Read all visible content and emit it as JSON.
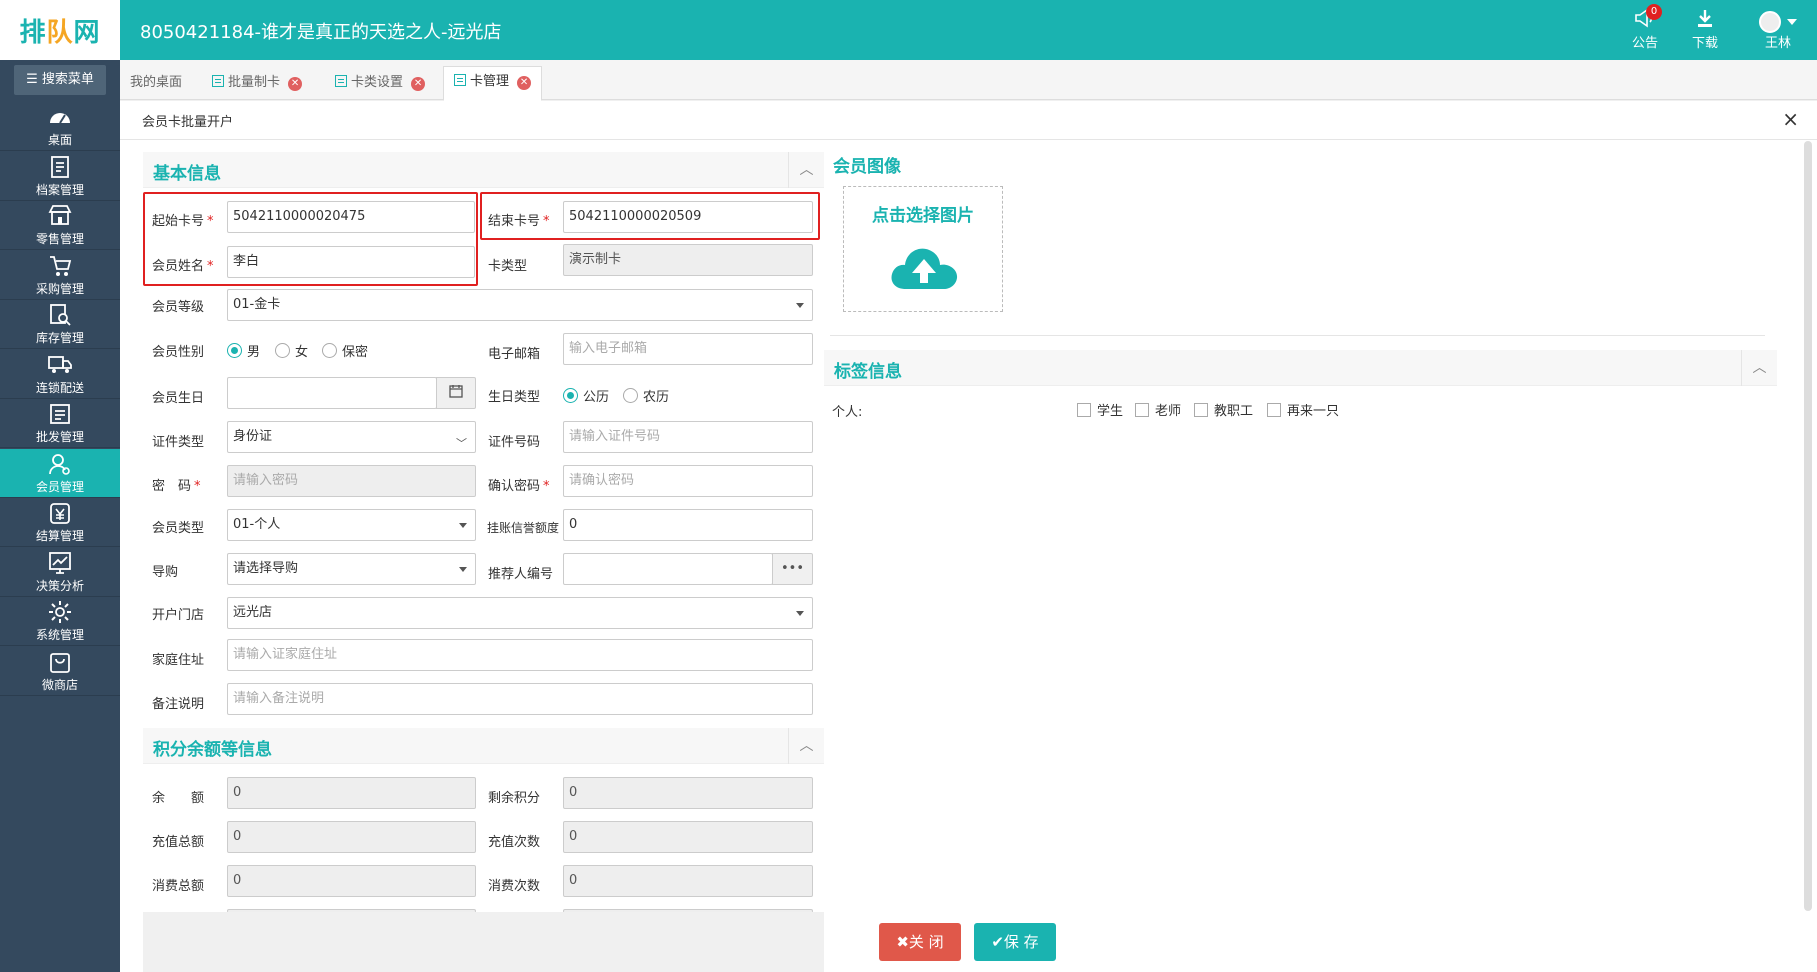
{
  "header": {
    "logo_main": "排",
    "logo_mid": "队",
    "logo_end": "网",
    "store_title": "8050421184-谁才是真正的天选之人-远光店",
    "announce_label": "公告",
    "announce_count": "0",
    "download_label": "下载",
    "user_name": "王林"
  },
  "sidebar": {
    "search_label": "搜索菜单",
    "items": [
      {
        "label": "桌面",
        "icon": "dashboard-icon"
      },
      {
        "label": "档案管理",
        "icon": "archive-icon"
      },
      {
        "label": "零售管理",
        "icon": "store-icon"
      },
      {
        "label": "采购管理",
        "icon": "cart-icon"
      },
      {
        "label": "库存管理",
        "icon": "inventory-icon"
      },
      {
        "label": "连锁配送",
        "icon": "truck-icon"
      },
      {
        "label": "批发管理",
        "icon": "wholesale-icon"
      },
      {
        "label": "会员管理",
        "icon": "member-icon"
      },
      {
        "label": "结算管理",
        "icon": "yen-icon"
      },
      {
        "label": "决策分析",
        "icon": "analysis-icon"
      },
      {
        "label": "系统管理",
        "icon": "gear-icon"
      },
      {
        "label": "微商店",
        "icon": "bag-icon"
      }
    ],
    "active_index": 7
  },
  "tabs": [
    {
      "label": "我的桌面"
    },
    {
      "label": "批量制卡"
    },
    {
      "label": "卡类设置"
    },
    {
      "label": "卡管理"
    }
  ],
  "panel": {
    "title": "会员卡批量开户",
    "close": "×"
  },
  "basic": {
    "section_title": "基本信息",
    "start_card_label": "起始卡号",
    "start_card_value": "5042110000020475",
    "end_card_label": "结束卡号",
    "end_card_value": "5042110000020509",
    "name_label": "会员姓名",
    "name_value": "李白",
    "card_type_label": "卡类型",
    "card_type_value": "演示制卡",
    "level_label": "会员等级",
    "level_value": "01-金卡",
    "gender_label": "会员性别",
    "gender_options": [
      "男",
      "女",
      "保密"
    ],
    "email_label": "电子邮箱",
    "email_placeholder": "输入电子邮箱",
    "birthday_label": "会员生日",
    "birth_type_label": "生日类型",
    "birth_type_options": [
      "公历",
      "农历"
    ],
    "id_type_label": "证件类型",
    "id_type_value": "身份证",
    "id_no_label": "证件号码",
    "id_no_placeholder": "请输入证件号码",
    "password_label": "密　码",
    "password_placeholder": "请输入密码",
    "confirm_label": "确认密码",
    "confirm_placeholder": "请确认密码",
    "member_type_label": "会员类型",
    "member_type_value": "01-个人",
    "credit_label": "挂账信誉额度",
    "credit_value": "0",
    "guide_label": "导购",
    "guide_value": "请选择导购",
    "referrer_label": "推荐人编号",
    "referrer_btn": "•••",
    "store_label": "开户门店",
    "store_value": "远光店",
    "address_label": "家庭住址",
    "address_placeholder": "请输入证家庭住址",
    "remark_label": "备注说明",
    "remark_placeholder": "请输入备注说明"
  },
  "balance": {
    "section_title": "积分余额等信息",
    "balance_label": "余　　额",
    "balance_value": "0",
    "points_label": "剩余积分",
    "points_value": "0",
    "recharge_total_label": "充值总额",
    "recharge_total_value": "0",
    "recharge_count_label": "充值次数",
    "recharge_count_value": "0",
    "spend_total_label": "消费总额",
    "spend_total_value": "0",
    "spend_count_label": "消费次数",
    "spend_count_value": "0"
  },
  "image": {
    "section_title": "会员图像",
    "upload_label": "点击选择图片"
  },
  "tags": {
    "section_title": "标签信息",
    "personal_label": "个人:",
    "options": [
      "学生",
      "老师",
      "教职工",
      "再来一只"
    ]
  },
  "buttons": {
    "close": "关 闭",
    "save": "保 存"
  },
  "colors": {
    "brand": "#1ab3b0",
    "sidebar": "#34495e",
    "danger": "#e0584a"
  }
}
